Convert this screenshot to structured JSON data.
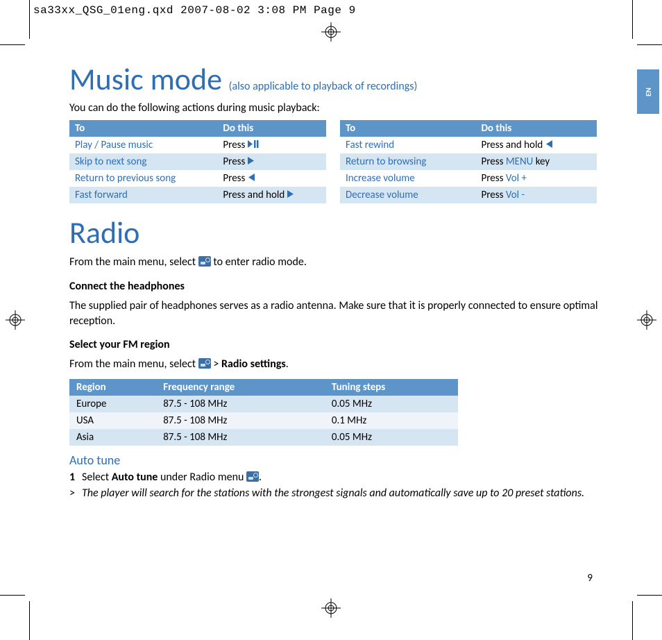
{
  "slug": "sa33xx_QSG_01eng.qxd  2007-08-02  3:08 PM  Page 9",
  "lang_tab": "EN",
  "music": {
    "title": "Music mode",
    "subtitle": "(also applicable to playback of recordings)",
    "intro": "You can do the following actions during music playback:",
    "header_to": "To",
    "header_do": "Do this",
    "left": [
      {
        "to": "Play / Pause music",
        "do_pre": "Press ",
        "sym": "play-pause"
      },
      {
        "to": "Skip to next song",
        "do_pre": "Press ",
        "sym": "next"
      },
      {
        "to": "Return to previous song",
        "do_pre": "Press ",
        "sym": "prev"
      },
      {
        "to": "Fast forward",
        "do_pre": "Press and hold ",
        "sym": "next"
      }
    ],
    "right": [
      {
        "to": "Fast rewind",
        "do_pre": "Press and hold ",
        "sym": "prev"
      },
      {
        "to": "Return to browsing",
        "do_pre": "Press ",
        "key": "MENU",
        "do_post": " key"
      },
      {
        "to": "Increase volume",
        "do_pre": "Press ",
        "key": "Vol +"
      },
      {
        "to": "Decrease volume",
        "do_pre": "Press ",
        "key": "Vol -"
      }
    ]
  },
  "radio": {
    "title": "Radio",
    "intro_pre": "From the main menu, select ",
    "intro_post": " to enter radio mode.",
    "connect_head": "Connect the headphones",
    "connect_body": "The supplied pair of headphones serves as a radio antenna. Make sure that it is properly connected to ensure optimal reception.",
    "region_head": "Select your FM region",
    "region_intro_pre": "From the main menu, select ",
    "region_intro_mid": " > ",
    "region_intro_strong": "Radio settings",
    "region_intro_post": ".",
    "region_table": {
      "h1": "Region",
      "h2": "Frequency range",
      "h3": "Tuning steps",
      "rows": [
        {
          "r": "Europe",
          "f": "87.5 - 108 MHz",
          "t": "0.05 MHz"
        },
        {
          "r": "USA",
          "f": "87.5 - 108 MHz",
          "t": "0.1 MHz"
        },
        {
          "r": "Asia",
          "f": "87.5 - 108 MHz",
          "t": "0.05 MHz"
        }
      ]
    },
    "auto_tune_head": "Auto tune",
    "step1_num": "1",
    "step1_pre": "Select ",
    "step1_strong": "Auto tune",
    "step1_mid": " under Radio menu ",
    "step1_post": ".",
    "result_mark": ">",
    "result_text": "The player will search for the stations with the strongest signals and automatically save up to 20 preset stations."
  },
  "page_number": "9"
}
